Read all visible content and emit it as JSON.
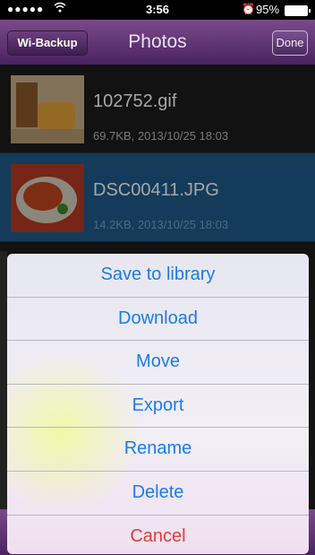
{
  "status": {
    "dots": "●●●●●",
    "time": "3:56",
    "battery": "95%"
  },
  "nav": {
    "left_button": "Wi-Backup",
    "title": "Photos",
    "right_button": "Done"
  },
  "files": [
    {
      "name": "102752.gif",
      "meta": "69.7KB, 2013/10/25 18:03"
    },
    {
      "name": "DSC00411.JPG",
      "meta": "14.2KB, 2013/10/25 18:03"
    }
  ],
  "actions": [
    "Save to library",
    "Download",
    "Move",
    "Export",
    "Rename",
    "Delete"
  ],
  "cancel": "Cancel"
}
